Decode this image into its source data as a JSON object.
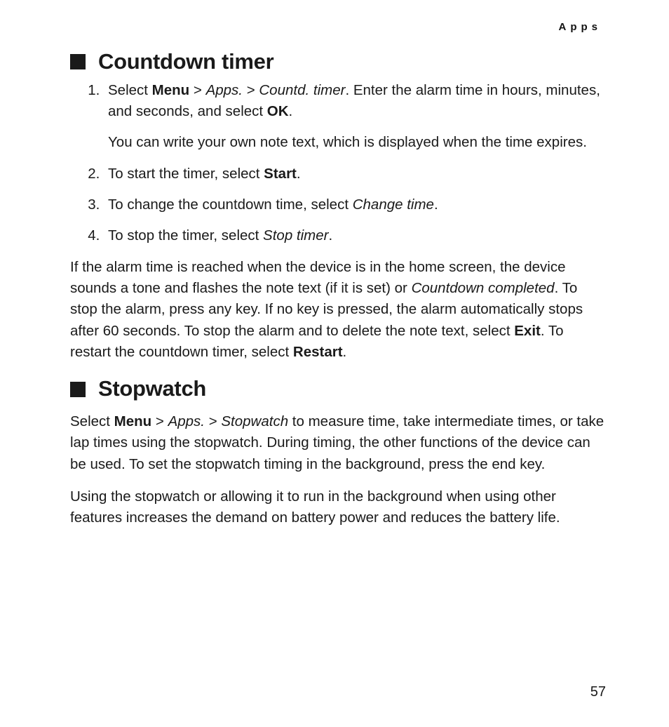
{
  "runningHead": "Apps",
  "pageNumber": "57",
  "sections": [
    {
      "title": "Countdown timer",
      "steps": [
        {
          "pre": "Select ",
          "b1": "Menu",
          "mid1": " > ",
          "i1": "Apps.",
          "mid2": " > ",
          "i2": "Countd. timer",
          "post": ". Enter the alarm time in hours, minutes, and seconds, and select ",
          "b2": "OK",
          "tail": ".",
          "sub": "You can write your own note text, which is displayed when the time expires."
        },
        {
          "pre": "To start the timer, select ",
          "b1": "Start",
          "tail": "."
        },
        {
          "pre": "To change the countdown time, select ",
          "i1": "Change time",
          "tail": "."
        },
        {
          "pre": "To stop the timer, select ",
          "i1": "Stop timer",
          "tail": "."
        }
      ],
      "para": {
        "t1": "If the alarm time is reached when the device is in the home screen, the device sounds a tone and flashes the note text (if it is set) or ",
        "i1": "Countdown completed",
        "t2": ". To stop the alarm, press any key. If no key is pressed, the alarm automatically stops after 60 seconds. To stop the alarm and to delete the note text, select ",
        "b1": "Exit",
        "t3": ". To restart the countdown timer, select ",
        "b2": "Restart",
        "t4": "."
      }
    },
    {
      "title": "Stopwatch",
      "para1": {
        "t1": "Select ",
        "b1": "Menu",
        "t2": " > ",
        "i1": "Apps.",
        "t3": " > ",
        "i2": "Stopwatch",
        "t4": " to measure time, take intermediate times, or take lap times using the stopwatch. During timing, the other functions of the device can be used. To set the stopwatch timing in the background, press the end key."
      },
      "para2": "Using the stopwatch or allowing it to run in the background when using other features increases the demand on battery power and reduces the battery life."
    }
  ]
}
